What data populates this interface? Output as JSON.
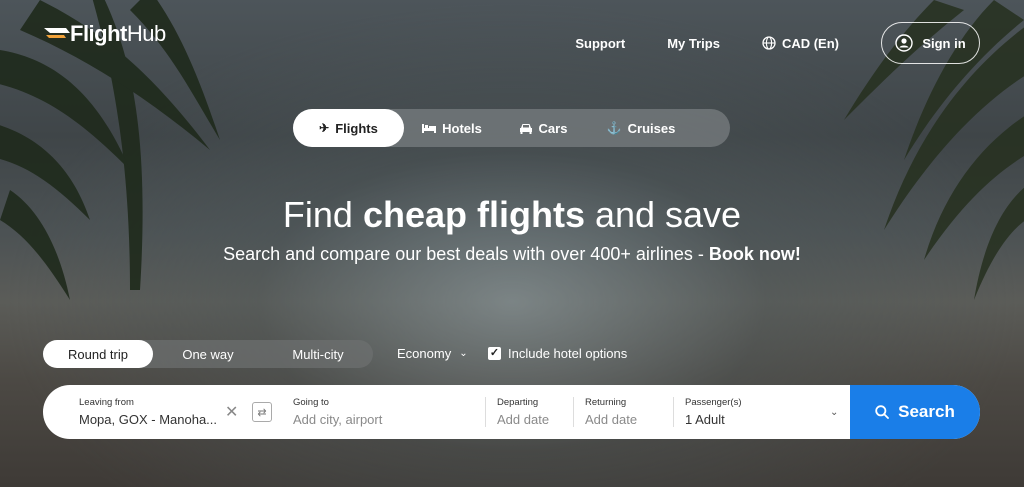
{
  "brand": {
    "name_bold": "Flight",
    "name_light": "Hub"
  },
  "nav": {
    "support": "Support",
    "my_trips": "My Trips",
    "currency": "CAD (En)",
    "sign_in": "Sign in"
  },
  "product_tabs": [
    {
      "label": "Flights",
      "icon": "airplane-icon",
      "active": true
    },
    {
      "label": "Hotels",
      "icon": "bed-icon",
      "active": false
    },
    {
      "label": "Cars",
      "icon": "car-icon",
      "active": false
    },
    {
      "label": "Cruises",
      "icon": "anchor-icon",
      "active": false
    }
  ],
  "hero": {
    "title_pre": "Find ",
    "title_bold": "cheap flights",
    "title_post": " and save",
    "subtitle_pre": "Search and compare our best deals with over 400+ airlines - ",
    "subtitle_bold": "Book now!"
  },
  "trip_types": [
    {
      "label": "Round trip",
      "active": true
    },
    {
      "label": "One way",
      "active": false
    },
    {
      "label": "Multi-city",
      "active": false
    }
  ],
  "cabin_class": "Economy",
  "hotel_option": {
    "label": "Include hotel options",
    "checked": true
  },
  "search": {
    "from_label": "Leaving from",
    "from_value": "Mopa, GOX - Manoha...",
    "to_label": "Going to",
    "to_placeholder": "Add city, airport",
    "depart_label": "Departing",
    "depart_placeholder": "Add date",
    "return_label": "Returning",
    "return_placeholder": "Add date",
    "pax_label": "Passenger(s)",
    "pax_value": "1 Adult",
    "button": "Search"
  },
  "colors": {
    "accent": "#1a7ee8"
  }
}
